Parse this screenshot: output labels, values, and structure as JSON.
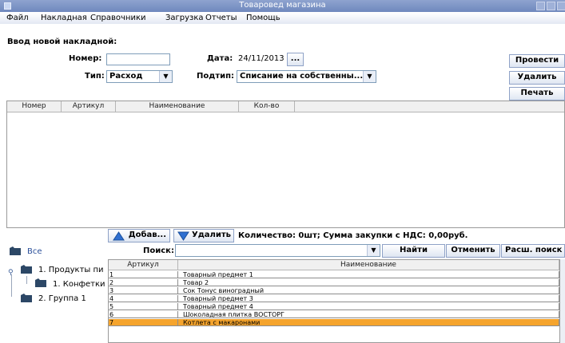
{
  "window": {
    "title": "Товаровед магазина"
  },
  "menu": {
    "items": [
      "Файл",
      "Накладная",
      "Справочники",
      "Загрузка",
      "Отчеты",
      "Помощь"
    ]
  },
  "form": {
    "section_title": "Ввод новой накладной:",
    "number_label": "Номер:",
    "number_value": "",
    "date_label": "Дата:",
    "date_value": "24/11/2013",
    "date_button": "...",
    "type_label": "Тип:",
    "type_value": "Расход",
    "subtype_label": "Подтип:",
    "subtype_value": "Списание на собственны..."
  },
  "actions": {
    "post": "Провести",
    "delete": "Удалить",
    "print": "Печать"
  },
  "invoice_table": {
    "columns": [
      "Номер",
      "Артикул",
      "Наименование",
      "Кол-во"
    ]
  },
  "toolbar2": {
    "add": "Добав...",
    "remove": "Удалить",
    "summary": "Количество: 0шт; Сумма закупки с НДС: 0,00руб."
  },
  "search": {
    "label": "Поиск:",
    "value": "",
    "find": "Найти",
    "cancel": "Отменить",
    "advanced": "Расш. поиск"
  },
  "tree": {
    "root": "Все",
    "node1": "1. Продукты пи",
    "node1_child": "1. Конфетки",
    "node2": "2. Группа 1"
  },
  "goods_table": {
    "columns": [
      "Артикул",
      "Наименование"
    ],
    "rows": [
      {
        "code": "1",
        "name": "Товарный предмет 1"
      },
      {
        "code": "2",
        "name": "Товар 2"
      },
      {
        "code": "3",
        "name": "Сок Тонус виноградный"
      },
      {
        "code": "4",
        "name": "Товарный предмет 3"
      },
      {
        "code": "5",
        "name": "Товарный предмет 4"
      },
      {
        "code": "6",
        "name": "Шоколадная плитка ВОСТОРГ"
      },
      {
        "code": "7",
        "name": "Котлета с макаронами"
      }
    ],
    "selected_index": 6
  },
  "colors": {
    "title_bar": "#7b92c4",
    "selection": "#f5a42d",
    "accent_blue": "#2f6fd0"
  }
}
